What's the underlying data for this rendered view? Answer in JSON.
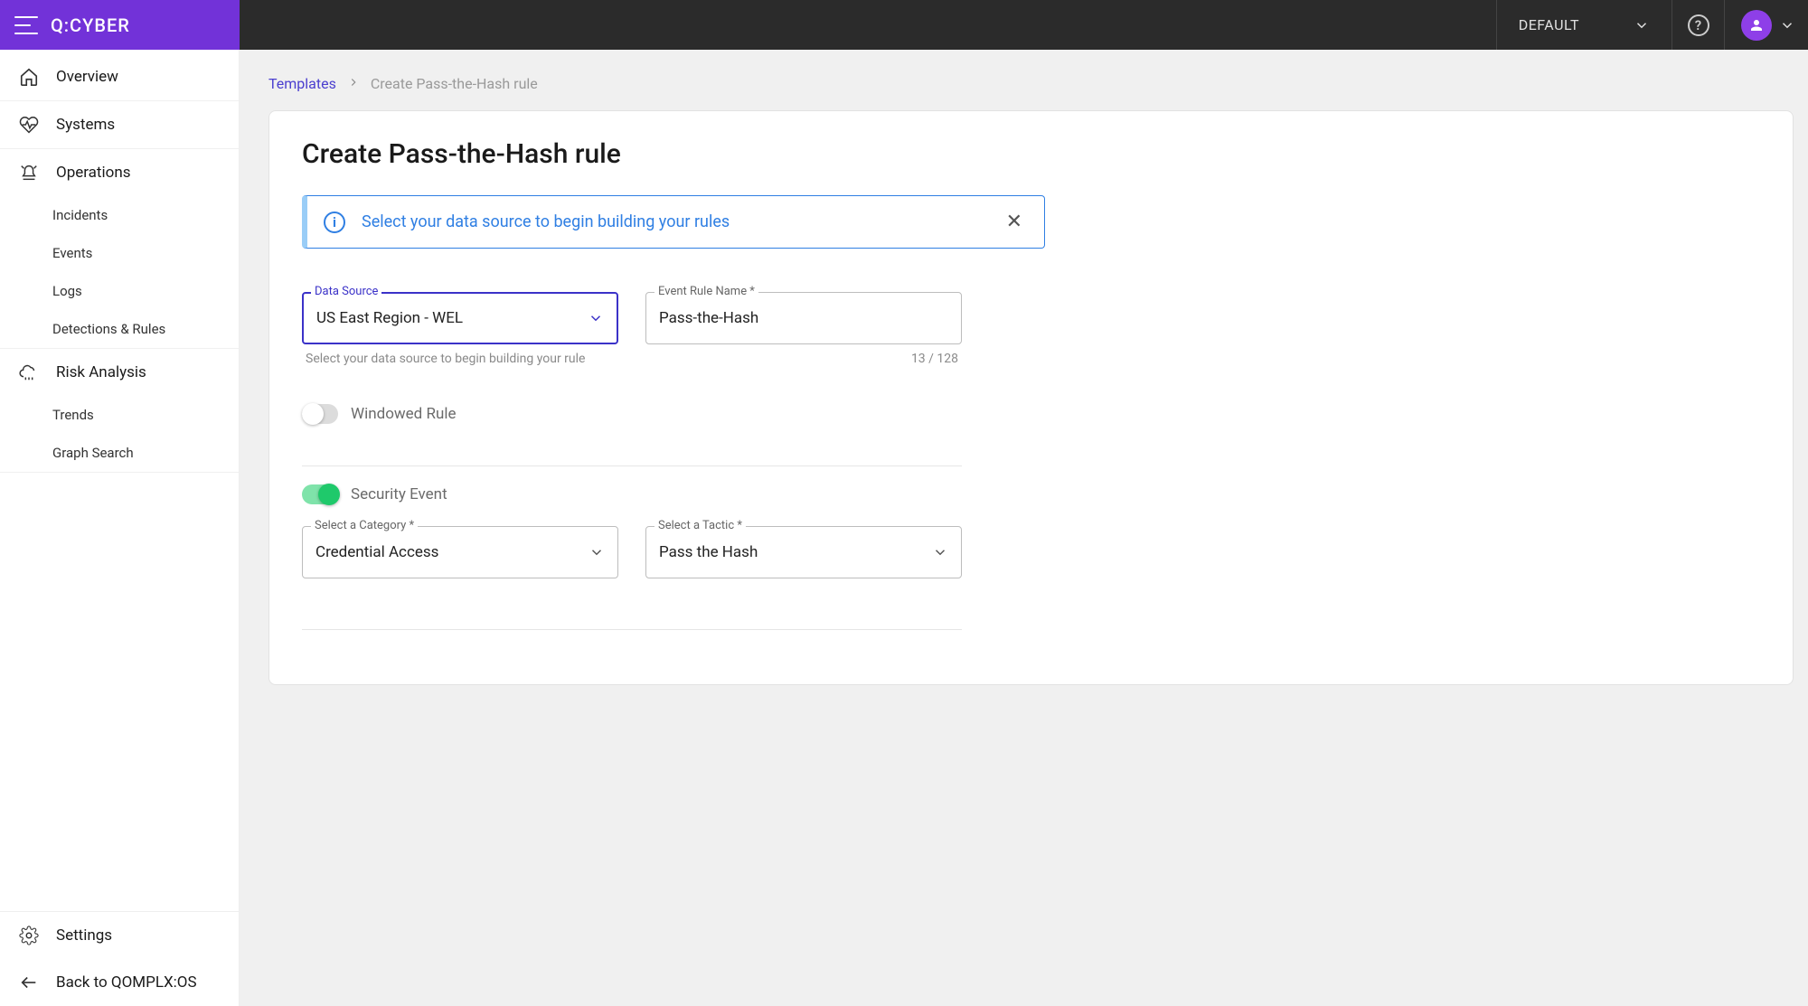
{
  "brand": "Q:CYBER",
  "topbar": {
    "selector": "DEFAULT",
    "help_tooltip": "?"
  },
  "sidebar": {
    "overview": "Overview",
    "systems": "Systems",
    "operations": "Operations",
    "operations_sub": {
      "incidents": "Incidents",
      "events": "Events",
      "logs": "Logs",
      "detections": "Detections & Rules"
    },
    "risk": "Risk Analysis",
    "risk_sub": {
      "trends": "Trends",
      "graph_search": "Graph Search"
    },
    "settings": "Settings",
    "back": "Back to QOMPLX:OS"
  },
  "breadcrumb": {
    "parent": "Templates",
    "current": "Create Pass-the-Hash rule"
  },
  "page": {
    "title": "Create Pass-the-Hash rule",
    "banner": "Select your data source to begin building your rules"
  },
  "form": {
    "data_source": {
      "label": "Data Source",
      "value": "US East Region - WEL",
      "help": "Select your data source to begin building your rule"
    },
    "rule_name": {
      "label": "Event Rule Name *",
      "value": "Pass-the-Hash",
      "counter": "13 / 128"
    },
    "windowed": {
      "label": "Windowed Rule",
      "on": false
    },
    "security": {
      "label": "Security Event",
      "on": true
    },
    "category": {
      "label": "Select a Category *",
      "value": "Credential Access"
    },
    "tactic": {
      "label": "Select a Tactic *",
      "value": "Pass the Hash"
    }
  }
}
